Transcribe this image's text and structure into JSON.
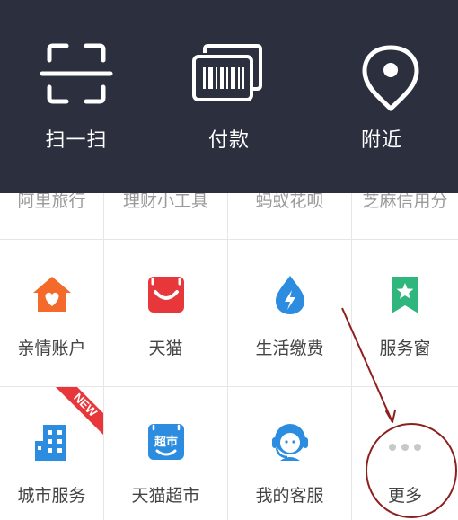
{
  "top_actions": [
    {
      "label": "扫一扫",
      "icon": "scan-icon"
    },
    {
      "label": "付款",
      "icon": "barcode-icon"
    },
    {
      "label": "附近",
      "icon": "location-pin-icon"
    }
  ],
  "partial_row": [
    {
      "label": "阿里旅行"
    },
    {
      "label": "理财小工具"
    },
    {
      "label": "蚂蚁花呗"
    },
    {
      "label": "芝麻信用分"
    }
  ],
  "grid_rows": [
    [
      {
        "label": "亲情账户",
        "icon": "family-house-icon"
      },
      {
        "label": "天猫",
        "icon": "tmall-icon"
      },
      {
        "label": "生活缴费",
        "icon": "utility-drop-icon"
      },
      {
        "label": "服务窗",
        "icon": "service-bookmark-icon"
      }
    ],
    [
      {
        "label": "城市服务",
        "icon": "city-building-icon"
      },
      {
        "label": "天猫超市",
        "icon": "tmall-supermarket-icon",
        "icon_text": "超市"
      },
      {
        "label": "我的客服",
        "icon": "customer-service-icon"
      },
      {
        "label": "更多",
        "icon": "more-dots-icon"
      }
    ]
  ],
  "badge": {
    "text": "NEW"
  },
  "colors": {
    "topbar": "#2b2f3e",
    "orange": "#f36a2b",
    "red": "#e8373a",
    "blue": "#2c8de0",
    "green": "#2fb67c",
    "annotation": "#8e1f1f"
  }
}
